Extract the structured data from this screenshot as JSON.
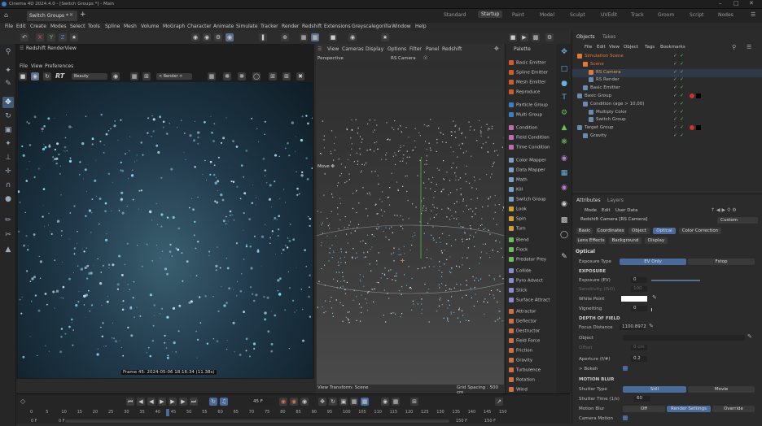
{
  "window": {
    "title": "Cinema 4D 2024.4.0 - [Switch Groups *] - Main",
    "doc_tab": "Switch Groups *"
  },
  "layouts": [
    "Standard",
    "Startup",
    "Paint",
    "Model",
    "Sculpt",
    "UVEdit",
    "Track",
    "Groom",
    "Script",
    "Nodes"
  ],
  "active_layout": "Startup",
  "menus": [
    "File",
    "Edit",
    "Create",
    "Modes",
    "Select",
    "Tools",
    "Spline",
    "Mesh",
    "Volume",
    "MoGraph",
    "Character",
    "Animate",
    "Simulate",
    "Tracker",
    "Render",
    "Redshift",
    "Extensions",
    "Greyscalegorilla",
    "Window",
    "Help"
  ],
  "render_view": {
    "title": "Redshift RenderView",
    "menus": [
      "File",
      "View",
      "Preferences"
    ],
    "colorspace": "Beauty",
    "render_dropdown": "< Render >",
    "status": "Frame  45:  2024-05-06  18:16:34  (11.38s)"
  },
  "viewport": {
    "menus": [
      "View",
      "Cameras",
      "Display",
      "Options",
      "Filter",
      "Panel",
      "Redshift"
    ],
    "label": "Perspective",
    "camera": "RS Camera",
    "tool": "Move ✥",
    "transform": "View Transform: Scene",
    "grid": "Grid Spacing : 500 cm"
  },
  "palette": {
    "title": "Palette",
    "items": [
      {
        "label": "Basic Emitter",
        "color": "#d05a2a"
      },
      {
        "label": "Spline Emitter",
        "color": "#d05a2a"
      },
      {
        "label": "Mesh Emitter",
        "color": "#d05a2a"
      },
      {
        "label": "Reproduce",
        "color": "#d05a2a"
      },
      {
        "label": "Particle Group",
        "color": "#3a7fc4"
      },
      {
        "label": "Multi Group",
        "color": "#3a7fc4"
      },
      {
        "label": "Condition",
        "color": "#c46ab0"
      },
      {
        "label": "Field Condition",
        "color": "#c46ab0"
      },
      {
        "label": "Time Condition",
        "color": "#c46ab0"
      },
      {
        "label": "Color Mapper",
        "color": "#7aa0c8"
      },
      {
        "label": "Data Mapper",
        "color": "#7aa0c8"
      },
      {
        "label": "Math",
        "color": "#7aa0c8"
      },
      {
        "label": "Kill",
        "color": "#7aa0c8"
      },
      {
        "label": "Switch Group",
        "color": "#7aa0c8"
      },
      {
        "label": "Look",
        "color": "#d0a030"
      },
      {
        "label": "Spin",
        "color": "#d0a030"
      },
      {
        "label": "Turn",
        "color": "#d0a030"
      },
      {
        "label": "Blend",
        "color": "#6bbf59"
      },
      {
        "label": "Flock",
        "color": "#6bbf59"
      },
      {
        "label": "Predator Prey",
        "color": "#6bbf59"
      },
      {
        "label": "Collide",
        "color": "#8a8ad0"
      },
      {
        "label": "Pyro Advect",
        "color": "#8a8ad0"
      },
      {
        "label": "Stick",
        "color": "#8a8ad0"
      },
      {
        "label": "Surface Attract",
        "color": "#8a8ad0"
      },
      {
        "label": "Attractor",
        "color": "#d07040"
      },
      {
        "label": "Deflector",
        "color": "#d07040"
      },
      {
        "label": "Destructor",
        "color": "#d07040"
      },
      {
        "label": "Field Force",
        "color": "#d07040"
      },
      {
        "label": "Friction",
        "color": "#d07040"
      },
      {
        "label": "Gravity",
        "color": "#d07040"
      },
      {
        "label": "Turbulence",
        "color": "#d07040"
      },
      {
        "label": "Rotation",
        "color": "#d07040"
      },
      {
        "label": "Wind",
        "color": "#d07040"
      }
    ]
  },
  "objects": {
    "tabs": [
      "Objects",
      "Takes"
    ],
    "menus": [
      "File",
      "Edit",
      "View",
      "Object",
      "Tags",
      "Bookmarks"
    ],
    "rows": [
      {
        "label": "Simulation Scene",
        "color": "#e07a3a",
        "indent": 0
      },
      {
        "label": "Scene",
        "color": "#e07a3a",
        "indent": 1
      },
      {
        "label": "RS Camera",
        "color": "#f0a040",
        "indent": 2
      },
      {
        "label": "RS Render",
        "color": "#bbbbbb",
        "indent": 2
      },
      {
        "label": "Basic Emitter",
        "color": "#bbbbbb",
        "indent": 1
      },
      {
        "label": "Basic Group",
        "color": "#bbbbbb",
        "indent": 0
      },
      {
        "label": "Condition (age > 10,00)",
        "color": "#bbbbbb",
        "indent": 1
      },
      {
        "label": "Multiply Color",
        "color": "#bbbbbb",
        "indent": 2
      },
      {
        "label": "Switch Group",
        "color": "#bbbbbb",
        "indent": 2
      },
      {
        "label": "Target Group",
        "color": "#bbbbbb",
        "indent": 0
      },
      {
        "label": "Gravity",
        "color": "#bbbbbb",
        "indent": 1
      }
    ]
  },
  "attributes": {
    "tabs": [
      "Attributes",
      "Layers"
    ],
    "menus": [
      "Mode",
      "Edit",
      "User Data"
    ],
    "object_name": "Redshift Camera [RS Camera]",
    "preset": "Custom",
    "subtabs_row1": [
      "Basic",
      "Coordinates",
      "Object",
      "Optical",
      "Color Correction"
    ],
    "subtabs_row2": [
      "Lens Effects",
      "Background",
      "Display"
    ],
    "active_subtab": "Optical",
    "section": "Optical",
    "exposure_type_label": "Exposure Type",
    "exposure_type_options": [
      "EV Only",
      "Fstop"
    ],
    "exposure_header": "EXPOSURE",
    "exposure_ev_label": "Exposure (EV)",
    "exposure_ev": "0",
    "sensitivity_label": "Sensitivity (ISO)",
    "sensitivity": "100",
    "white_point_label": "White Point",
    "vignetting_label": "Vignetting",
    "vignetting": "0",
    "dof_header": "DEPTH OF FIELD",
    "focus_distance_label": "Focus Distance",
    "focus_distance": "1100.8972",
    "object_label": "Object",
    "offset_label": "Offset",
    "offset": "0 cm",
    "aperture_label": "Aperture (f/#)",
    "aperture": "0.2",
    "bokeh_label": "> Bokeh",
    "motion_blur_header": "MOTION BLUR",
    "shutter_type_label": "Shutter Type",
    "shutter_type_options": [
      "Still",
      "Movie"
    ],
    "shutter_time_label": "Shutter Time (1/s)",
    "shutter_time": "60",
    "motion_blur_label": "Motion Blur",
    "motion_blur_options": [
      "Off",
      "Render Settings",
      "Override"
    ],
    "camera_motion_label": "Camera Motion"
  },
  "timeline": {
    "ticks": [
      "0",
      "5",
      "10",
      "15",
      "20",
      "25",
      "30",
      "35",
      "40",
      "45",
      "50",
      "55",
      "60",
      "65",
      "70",
      "75",
      "80",
      "85",
      "90",
      "95",
      "100",
      "105",
      "110",
      "115",
      "120",
      "125",
      "130",
      "135",
      "140",
      "145",
      "150"
    ],
    "current_frame": "45 F",
    "start": "0 F",
    "start2": "0 F",
    "end": "150 F",
    "end2": "150 F"
  }
}
